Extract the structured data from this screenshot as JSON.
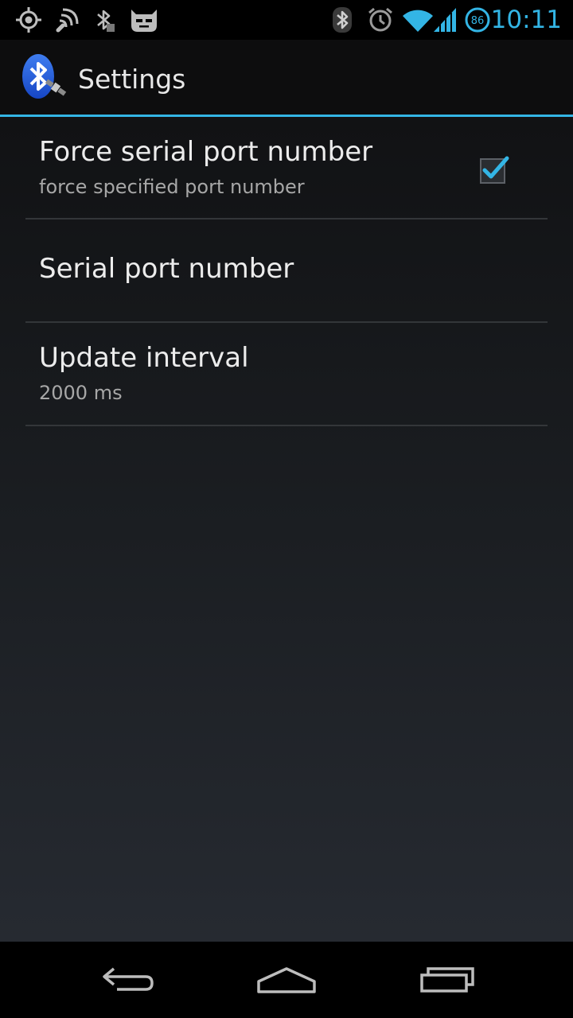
{
  "status_bar": {
    "time": "10:11",
    "battery_level": "86",
    "notification_icons": [
      "gps-icon",
      "signal-waves-icon",
      "bluetooth-disabled-icon",
      "cyanogen-mascot-icon"
    ],
    "system_icons": [
      "bluetooth-icon",
      "alarm-clock-icon",
      "wifi-icon",
      "cell-signal-icon",
      "battery-icon"
    ],
    "accent_color": "#33b5e5"
  },
  "action_bar": {
    "title": "Settings",
    "app_icon": "bluetooth-gps-app-icon"
  },
  "preferences": [
    {
      "title": "Force serial port number",
      "summary": "force specified port number",
      "has_checkbox": true,
      "checked": true
    },
    {
      "title": "Serial port number",
      "summary": ""
    },
    {
      "title": "Update interval",
      "summary": "2000 ms"
    }
  ],
  "nav_bar": {
    "buttons": [
      "back-icon",
      "home-icon",
      "recent-apps-icon"
    ]
  }
}
